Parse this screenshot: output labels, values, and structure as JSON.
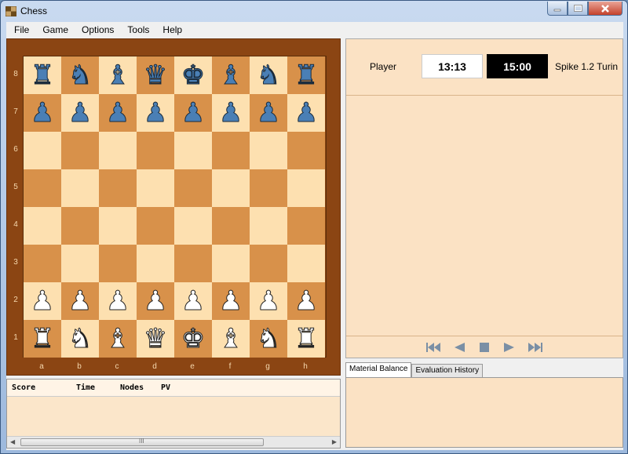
{
  "window": {
    "title": "Chess"
  },
  "menu": [
    "File",
    "Game",
    "Options",
    "Tools",
    "Help"
  ],
  "board": {
    "ranks": [
      "8",
      "7",
      "6",
      "5",
      "4",
      "3",
      "2",
      "1"
    ],
    "files": [
      "a",
      "b",
      "c",
      "d",
      "e",
      "f",
      "g",
      "h"
    ],
    "position": [
      [
        "bR",
        "bN",
        "bB",
        "bQ",
        "bK",
        "bB",
        "bN",
        "bR"
      ],
      [
        "bP",
        "bP",
        "bP",
        "bP",
        "bP",
        "bP",
        "bP",
        "bP"
      ],
      [
        "",
        "",
        "",
        "",
        "",
        "",
        "",
        ""
      ],
      [
        "",
        "",
        "",
        "",
        "",
        "",
        "",
        ""
      ],
      [
        "",
        "",
        "",
        "",
        "",
        "",
        "",
        ""
      ],
      [
        "",
        "",
        "",
        "",
        "",
        "",
        "",
        ""
      ],
      [
        "wP",
        "wP",
        "wP",
        "wP",
        "wP",
        "wP",
        "wP",
        "wP"
      ],
      [
        "wR",
        "wN",
        "wB",
        "wQ",
        "wK",
        "wB",
        "wN",
        "wR"
      ]
    ],
    "colors": {
      "light": "#fde0b0",
      "dark": "#d8914a",
      "frame": "#8b4513"
    }
  },
  "engine_output": {
    "columns": [
      "Score",
      "Time",
      "Nodes",
      "PV"
    ],
    "scroll_label": "III"
  },
  "clocks": {
    "player_label": "Player",
    "white_time": "13:13",
    "black_time": "15:00",
    "engine_name": "Spike 1.2 Turin"
  },
  "navigation": {
    "buttons": [
      "first-move-icon",
      "previous-move-icon",
      "stop-icon",
      "next-move-icon",
      "last-move-icon"
    ]
  },
  "tabs": [
    "Material Balance",
    "Evaluation History"
  ]
}
